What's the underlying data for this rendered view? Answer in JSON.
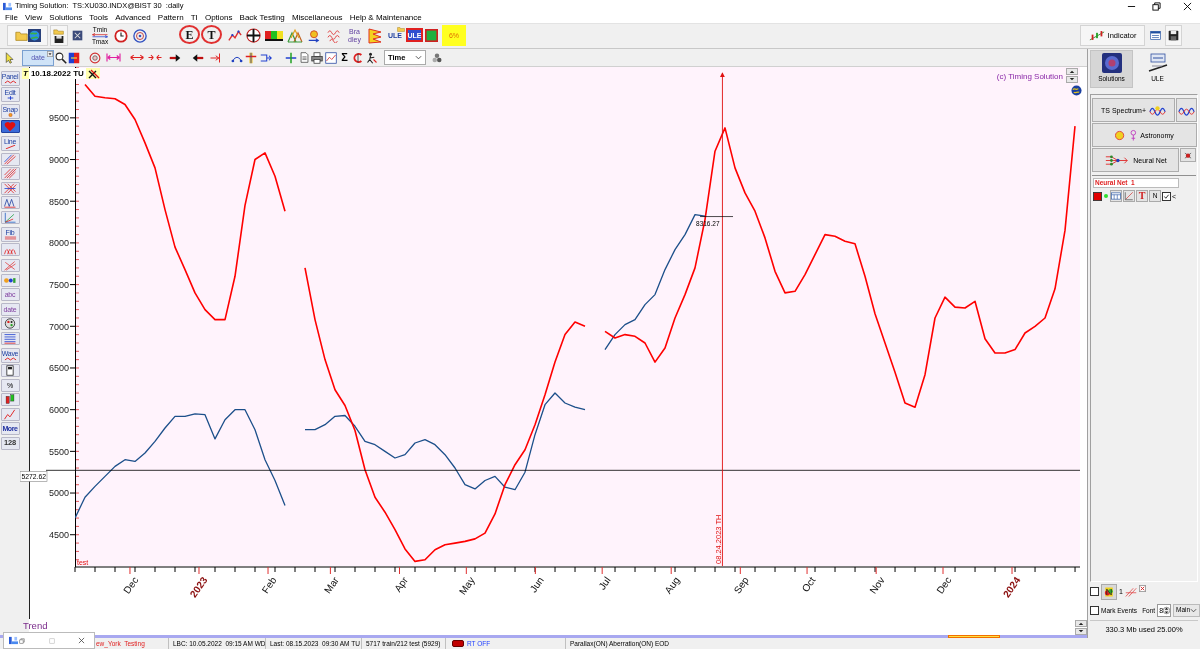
{
  "window": {
    "title": "Timing Solution:  TS:XU030.INDX@BIST 30  :daily"
  },
  "menu": [
    "File",
    "View",
    "Solutions",
    "Tools",
    "Advanced",
    "Pattern",
    "TI",
    "Options",
    "Back Testing",
    "Miscellaneous",
    "Help & Maintenance"
  ],
  "toolbar": {
    "tmin": "Tmin",
    "tmax": "Tmax",
    "e_button": "E",
    "t_button": "T",
    "bradley": [
      "Bra",
      "dley"
    ],
    "ule_button": "ULE",
    "ule_framed_button": "ULE",
    "percent_button": "6%",
    "indicator_button": "Indicator"
  },
  "drawing_toolbar": {
    "date_select": "date",
    "sum_button": "Σ",
    "time_select": "Time"
  },
  "tools": {
    "panel": "Panel",
    "edit": "Edit",
    "snap": "Snap",
    "line": "Line",
    "fib": "Fib",
    "text": "abc",
    "date": "date",
    "wave": "Wave",
    "percent": "%",
    "more": "More",
    "count": "128"
  },
  "chart": {
    "cursor": {
      "mark": "T",
      "date": "10.18.2022 TU"
    },
    "copyright": "(c) Timing Solution",
    "series_label": "test",
    "panel_label": "Trend",
    "chart_data": {
      "type": "line",
      "x": [
        2022.8475,
        2022.8598,
        2022.8721,
        2022.8844,
        2022.8967,
        2022.909,
        2022.9213,
        2022.9336,
        2022.9459,
        2022.9582,
        2022.9705,
        2022.9828,
        2022.9951,
        2023.0074,
        2023.0197,
        2023.032,
        2023.0443,
        2023.0566,
        2023.0689,
        2023.0812,
        2023.0935,
        2023.1058,
        2023.1181,
        2023.1304,
        2023.1427,
        2023.155,
        2023.1673,
        2023.1796,
        2023.1919,
        2023.2042,
        2023.2165,
        2023.2288,
        2023.2411,
        2023.2534,
        2023.2657,
        2023.278,
        2023.2903,
        2023.3026,
        2023.3149,
        2023.3272,
        2023.3395,
        2023.3518,
        2023.3641,
        2023.3764,
        2023.3887,
        2023.401,
        2023.4133,
        2023.4256,
        2023.4379,
        2023.4502,
        2023.4625,
        2023.4748,
        2023.4871,
        2023.4994,
        2023.5117,
        2023.524,
        2023.5363,
        2023.5486,
        2023.5609,
        2023.5732,
        2023.5855,
        2023.5978,
        2023.6101,
        2023.6224,
        2023.6347,
        2023.647,
        2023.6593,
        2023.6716,
        2023.6839,
        2023.6962,
        2023.7085,
        2023.7208,
        2023.7331,
        2023.7454,
        2023.7577,
        2023.77,
        2023.7823,
        2023.7946,
        2023.8069,
        2023.8192,
        2023.8315,
        2023.8438,
        2023.8561,
        2023.8684,
        2023.8807,
        2023.893,
        2023.9053,
        2023.9176,
        2023.9299,
        2023.9422,
        2023.9545,
        2023.9668,
        2023.9791,
        2023.9914,
        2024.0037,
        2024.016,
        2024.0283,
        2024.0406,
        2024.0529,
        2024.0652,
        2024.0775
      ],
      "series": [
        {
          "color": "#1c4f8a",
          "values": [
            4700,
            4950,
            5080,
            5200,
            5320,
            5400,
            5380,
            5480,
            5620,
            5780,
            5920,
            5920,
            5950,
            5940,
            5650,
            5880,
            6000,
            6000,
            5760,
            5400,
            5150,
            4850,
            null,
            5760,
            5760,
            5820,
            5920,
            5930,
            5800,
            5620,
            5580,
            5500,
            5420,
            5460,
            5600,
            5640,
            5580,
            5460,
            5300,
            5100,
            5050,
            5150,
            5200,
            5070,
            5040,
            5250,
            5700,
            6060,
            6200,
            6080,
            6030,
            6000,
            null,
            6720,
            6900,
            7020,
            7080,
            7260,
            7380,
            7680,
            7920,
            8100,
            8340,
            8320,
            null,
            null,
            null,
            null,
            null,
            null,
            null,
            null,
            null,
            null,
            null,
            null,
            null,
            null,
            null,
            null,
            null,
            null,
            null,
            null,
            null,
            null,
            null,
            null,
            null,
            null,
            null,
            null,
            null,
            null,
            null,
            null,
            null,
            null,
            null,
            null,
            null
          ]
        },
        {
          "color": "#ff0000",
          "values": [
            null,
            9900,
            9760,
            9740,
            9730,
            9660,
            9480,
            9200,
            8900,
            8400,
            7950,
            7680,
            7400,
            7200,
            7080,
            7080,
            7600,
            8450,
            9000,
            9080,
            8800,
            8380,
            null,
            7700,
            7080,
            6600,
            6240,
            6050,
            5750,
            5280,
            4950,
            4770,
            4560,
            4330,
            4180,
            4200,
            4320,
            4380,
            4400,
            4420,
            4450,
            4520,
            4750,
            5100,
            5340,
            5520,
            5820,
            6180,
            6570,
            6900,
            7050,
            7000,
            null,
            6940,
            6860,
            6900,
            6880,
            6800,
            6570,
            6740,
            7100,
            7380,
            7700,
            8280,
            9100,
            9380,
            8900,
            8600,
            8380,
            8060,
            7660,
            7400,
            7420,
            7620,
            7860,
            8100,
            8080,
            8020,
            7990,
            7600,
            7150,
            6800,
            6450,
            6080,
            6030,
            6420,
            7100,
            7350,
            7230,
            7220,
            7300,
            6850,
            6680,
            6680,
            6720,
            6920,
            7000,
            7100,
            7450,
            8150,
            9400
          ]
        }
      ],
      "xlim": [
        2022.8475,
        2024.0836
      ],
      "ylim": [
        4125,
        10110
      ],
      "xticks": [
        {
          "value": 2022.9151,
          "label": "Dec"
        },
        2023,
        {
          "value": 2023.0849,
          "label": "Feb"
        },
        {
          "value": 2023.1616,
          "label": "Mar"
        },
        {
          "value": 2023.2466,
          "label": "Apr"
        },
        {
          "value": 2023.3288,
          "label": "May"
        },
        {
          "value": 2023.4137,
          "label": "Jun"
        },
        {
          "value": 2023.4959,
          "label": "Jul"
        },
        {
          "value": 2023.5808,
          "label": "Aug"
        },
        {
          "value": 2023.6658,
          "label": "Sep"
        },
        {
          "value": 2023.7479,
          "label": "Oct"
        },
        {
          "value": 2023.8329,
          "label": "Nov"
        },
        {
          "value": 2023.9151,
          "label": "Dec"
        },
        2024
      ],
      "yticks": [
        4500,
        5000,
        5500,
        6000,
        6500,
        7000,
        7500,
        8000,
        8500,
        9000,
        9500
      ],
      "ref_lines": [
        {
          "axis": "y",
          "value": 5272.62,
          "label": "5272.62"
        },
        {
          "axis": "x",
          "value": 2023.6438,
          "label": "08.24.2023 TH"
        }
      ],
      "annotations": [
        {
          "x": 2023.6224,
          "y": 8316.27,
          "text": "8316.27"
        }
      ]
    }
  },
  "right_panel": {
    "tiles": [
      {
        "label": "Solutions",
        "selected": true
      },
      {
        "label": "ULE",
        "selected": false
      }
    ],
    "modules": [
      "TS Spectrum+",
      "Astronomy",
      "Neural Net"
    ],
    "model": {
      "name": "Neural Net  1",
      "text_button": "T",
      "n_button": "N",
      "checked": true,
      "collapse": "<"
    },
    "layer": {
      "checked": false,
      "count": "1"
    },
    "mark_events": {
      "label": "Mark Events",
      "checked": false
    },
    "font": {
      "label": "Font",
      "value": "8"
    },
    "view_select": "Main",
    "memory": "330.3 Mb used 25.00%"
  },
  "status_bar": {
    "location": "ew_York  Testing",
    "lbc": "LBC: 10.05.2022  09:15 AM WD",
    "last": "Last: 08.15.2023  09:30 AM TU",
    "samples": "5717 train/212 test (5929)",
    "realtime": "RT OFF",
    "flags": "Parallax(ON) Aberration(ON) EOD"
  }
}
